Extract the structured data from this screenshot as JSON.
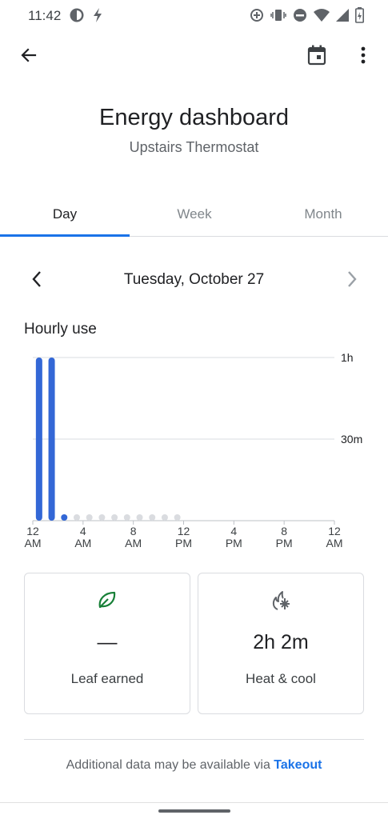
{
  "status_bar": {
    "time": "11:42",
    "left_icons": [
      "data-saver-icon",
      "flash-icon"
    ],
    "right_icons": [
      "sync-icon",
      "vibrate-icon",
      "do-not-disturb-icon",
      "wifi-icon",
      "signal-icon",
      "battery-icon"
    ]
  },
  "app_bar": {
    "back_icon": "back-arrow-icon",
    "calendar_icon": "calendar-icon",
    "more_icon": "more-vert-icon"
  },
  "header": {
    "title": "Energy dashboard",
    "subtitle": "Upstairs Thermostat"
  },
  "tabs": [
    {
      "label": "Day",
      "active": true
    },
    {
      "label": "Week",
      "active": false
    },
    {
      "label": "Month",
      "active": false
    }
  ],
  "date_nav": {
    "label": "Tuesday, October 27",
    "prev_icon": "chevron-left-icon",
    "next_icon": "chevron-right-icon"
  },
  "section_title": "Hourly use",
  "chart_data": {
    "type": "bar",
    "title": "Hourly use",
    "y_unit": "minutes",
    "ylim": [
      0,
      60
    ],
    "y_ticks": [
      {
        "value": 60,
        "label": "1h"
      },
      {
        "value": 30,
        "label": "30m"
      }
    ],
    "x_ticks": [
      {
        "hour": 0,
        "line1": "12",
        "line2": "AM"
      },
      {
        "hour": 4,
        "line1": "4",
        "line2": "AM"
      },
      {
        "hour": 8,
        "line1": "8",
        "line2": "AM"
      },
      {
        "hour": 12,
        "line1": "12",
        "line2": "PM"
      },
      {
        "hour": 16,
        "line1": "4",
        "line2": "PM"
      },
      {
        "hour": 20,
        "line1": "8",
        "line2": "PM"
      },
      {
        "hour": 24,
        "line1": "12",
        "line2": "AM"
      }
    ],
    "hours": [
      0,
      1,
      2,
      3,
      4,
      5,
      6,
      7,
      8,
      9,
      10,
      11
    ],
    "values": [
      60,
      60,
      2,
      0,
      0,
      0,
      0,
      0,
      0,
      0,
      0,
      0
    ],
    "bar_color": "#3367d6",
    "empty_color": "#dadce0",
    "grid": true
  },
  "cards": [
    {
      "icon": "leaf-icon",
      "value": "—",
      "label": "Leaf earned",
      "icon_color": "#188038"
    },
    {
      "icon": "heat-cool-icon",
      "value": "2h 2m",
      "label": "Heat & cool",
      "icon_color": "#5f6368"
    }
  ],
  "footer": {
    "text": "Additional data may be available via ",
    "link": "Takeout"
  },
  "colors": {
    "accent": "#1a73e8",
    "text_primary": "#202124",
    "text_secondary": "#5f6368"
  }
}
